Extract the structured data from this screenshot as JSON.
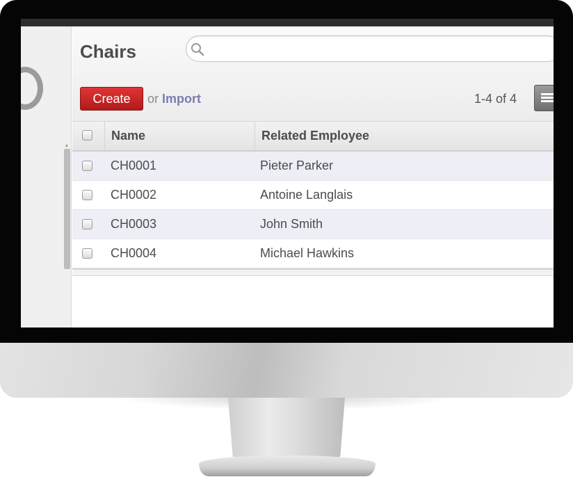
{
  "page": {
    "title": "Chairs",
    "search": {
      "value": "",
      "placeholder": ""
    },
    "buttons": {
      "create_label": "Create",
      "or_text": "or",
      "import_label": "Import"
    },
    "pager": "1-4 of 4",
    "view_icon": "list-view-icon"
  },
  "table": {
    "columns": [
      "Name",
      "Related Employee"
    ],
    "rows": [
      {
        "name": "CH0001",
        "employee": "Pieter Parker"
      },
      {
        "name": "CH0002",
        "employee": "Antoine Langlais"
      },
      {
        "name": "CH0003",
        "employee": "John Smith"
      },
      {
        "name": "CH0004",
        "employee": "Michael Hawkins"
      }
    ]
  },
  "colors": {
    "create_button": "#c52222",
    "import_link": "#7b7bb0",
    "odd_row": "#eeeef7"
  }
}
